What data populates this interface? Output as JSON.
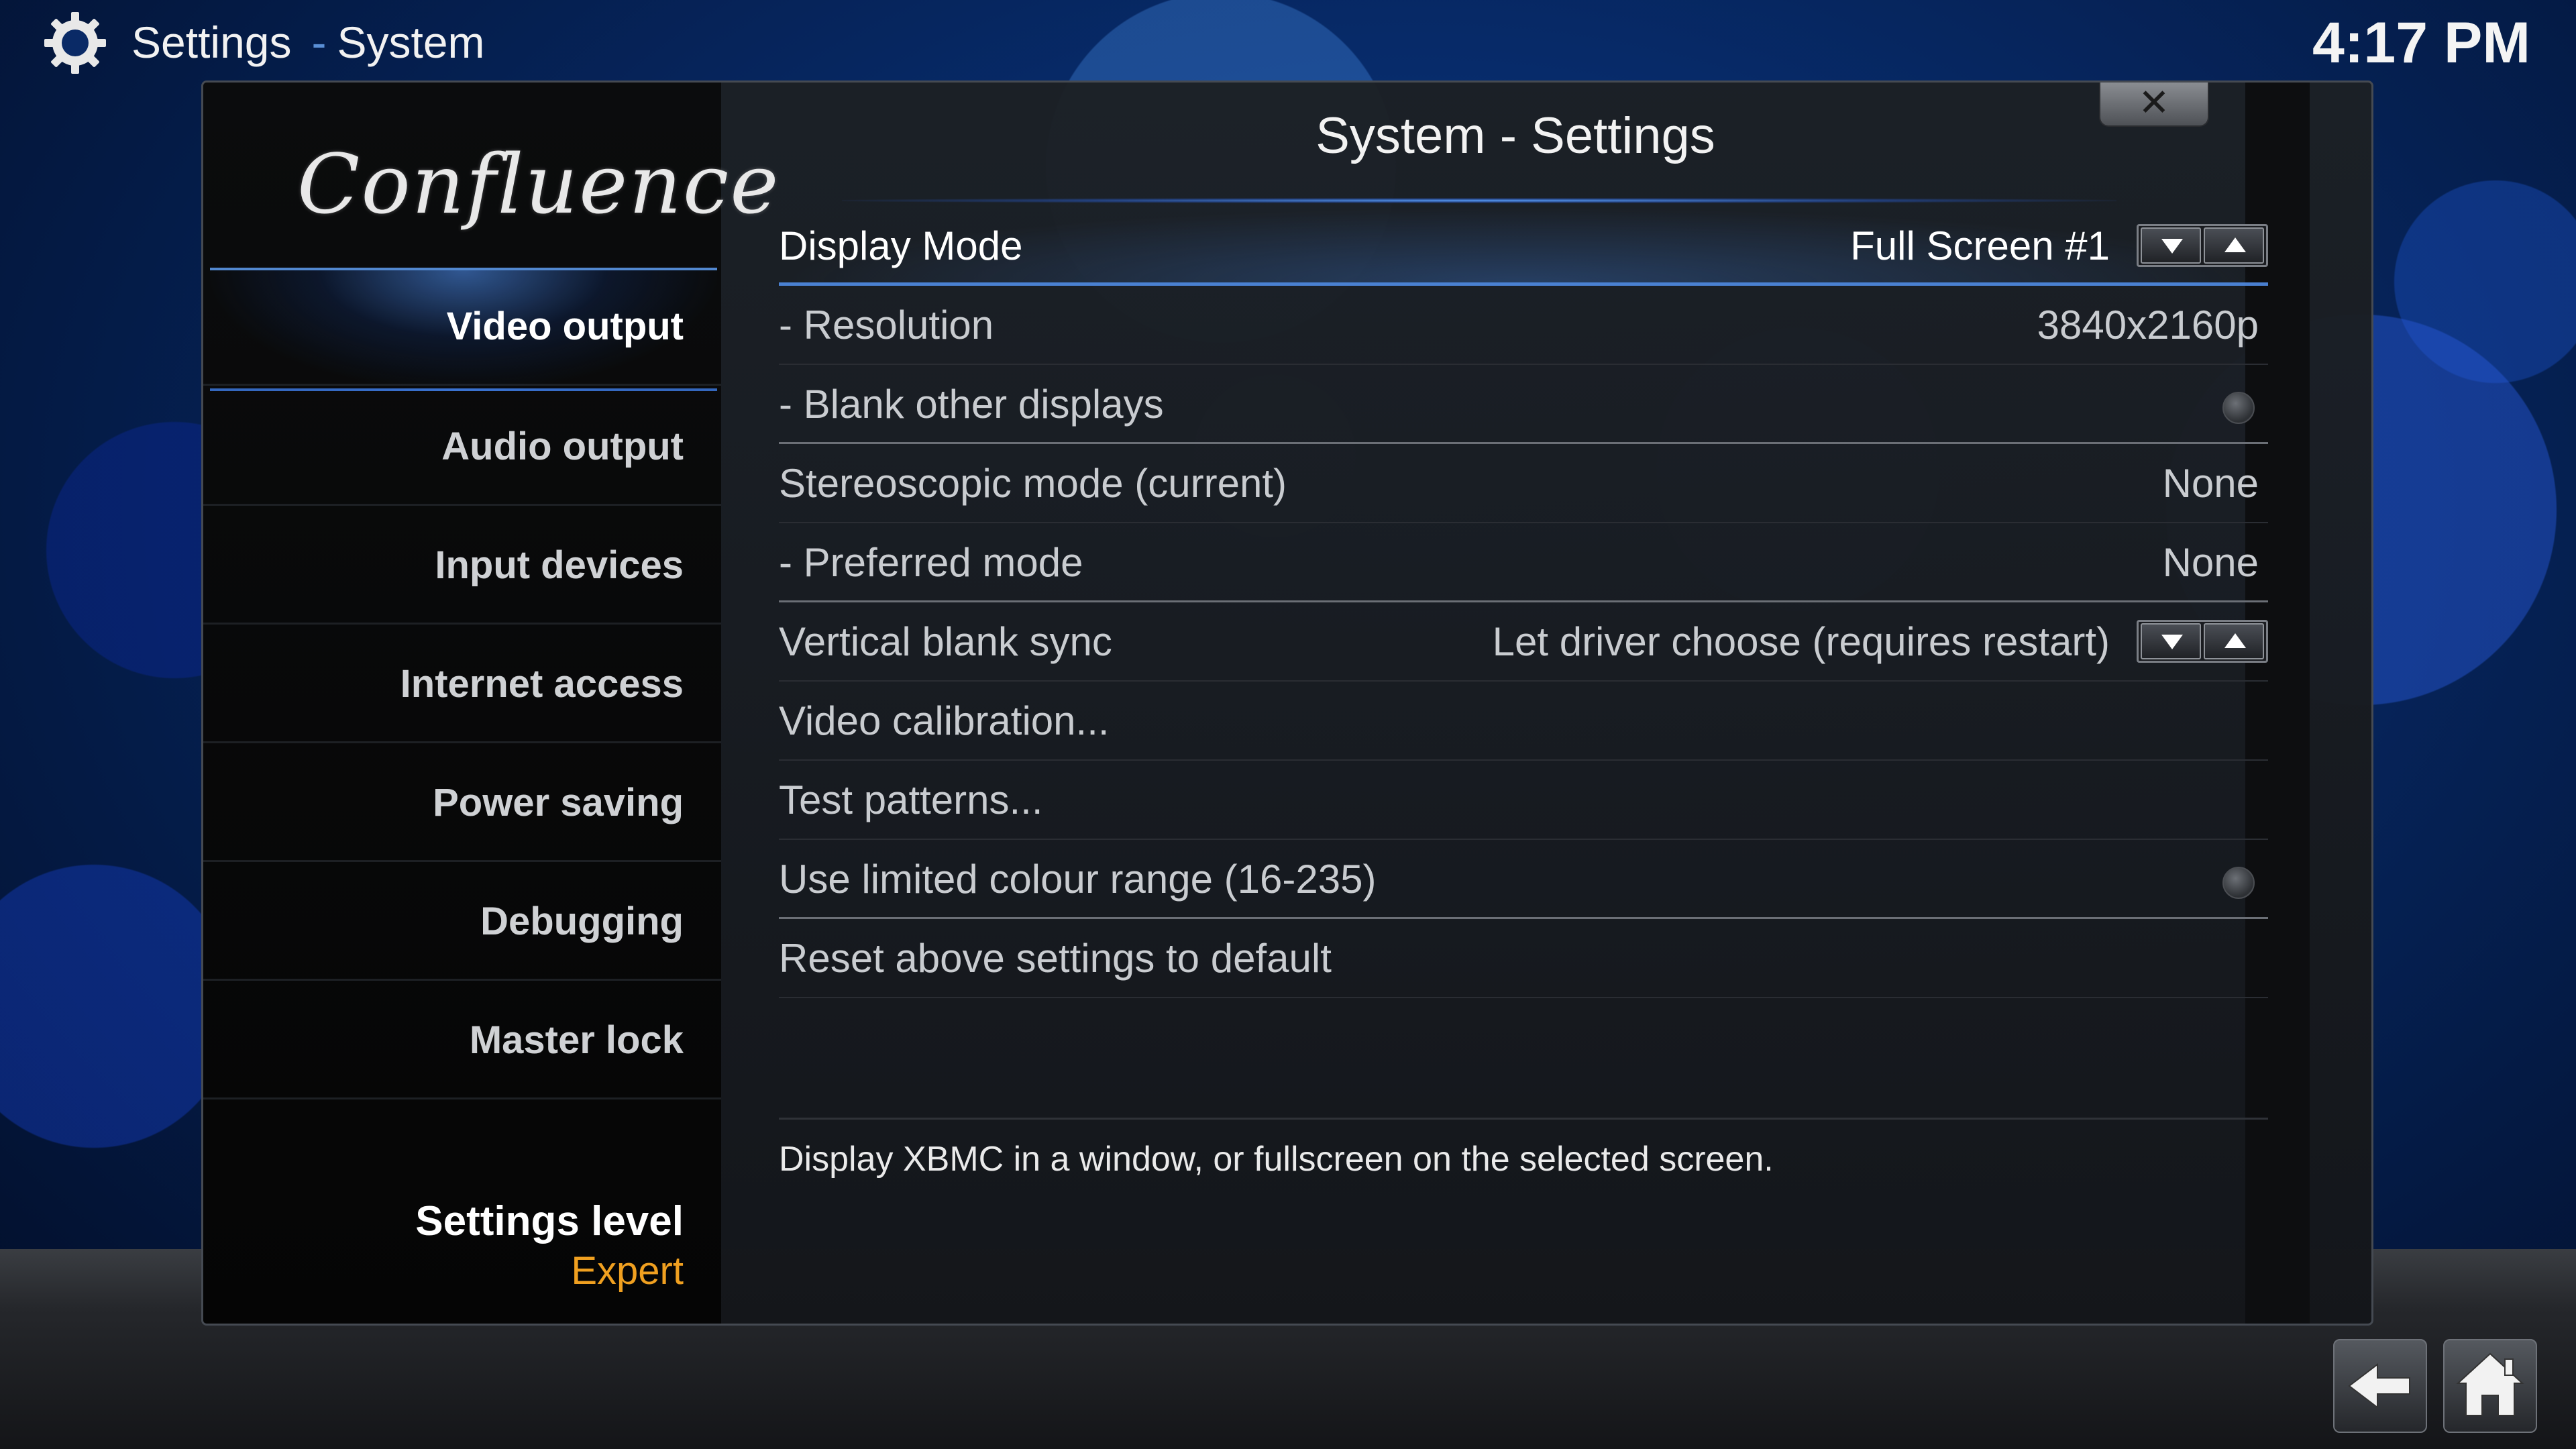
{
  "header": {
    "section": "Settings",
    "subsection": "System",
    "separator": "-",
    "clock": "4:17 PM"
  },
  "sidebar": {
    "logo_text": "Confluence",
    "items": [
      {
        "label": "Video output",
        "active": true
      },
      {
        "label": "Audio output"
      },
      {
        "label": "Input devices"
      },
      {
        "label": "Internet access"
      },
      {
        "label": "Power saving"
      },
      {
        "label": "Debugging"
      },
      {
        "label": "Master lock"
      }
    ],
    "settings_level_label": "Settings level",
    "settings_level_value": "Expert"
  },
  "main": {
    "title": "System - Settings",
    "close_label": "✕",
    "settings": [
      {
        "label": "Display Mode",
        "value": "Full Screen #1",
        "control": "spinner"
      },
      {
        "label": "- Resolution",
        "value": "3840x2160p"
      },
      {
        "label": "- Blank other displays",
        "control": "radio"
      },
      {
        "label": "Stereoscopic mode (current)",
        "value": "None"
      },
      {
        "label": "- Preferred mode",
        "value": "None"
      },
      {
        "label": "Vertical blank sync",
        "value": "Let driver choose (requires restart)",
        "control": "spinner"
      },
      {
        "label": "Video calibration..."
      },
      {
        "label": "Test patterns..."
      },
      {
        "label": "Use limited colour range (16-235)",
        "control": "radio"
      },
      {
        "label": "Reset above settings to default"
      }
    ],
    "description": "Display XBMC in a window, or fullscreen on the selected screen."
  },
  "icons": {
    "gear": "gear-icon",
    "back": "back-arrow-icon",
    "home": "home-icon"
  },
  "colors": {
    "accent_blue": "#5a8fd6",
    "settings_level_value": "#f0a020"
  }
}
